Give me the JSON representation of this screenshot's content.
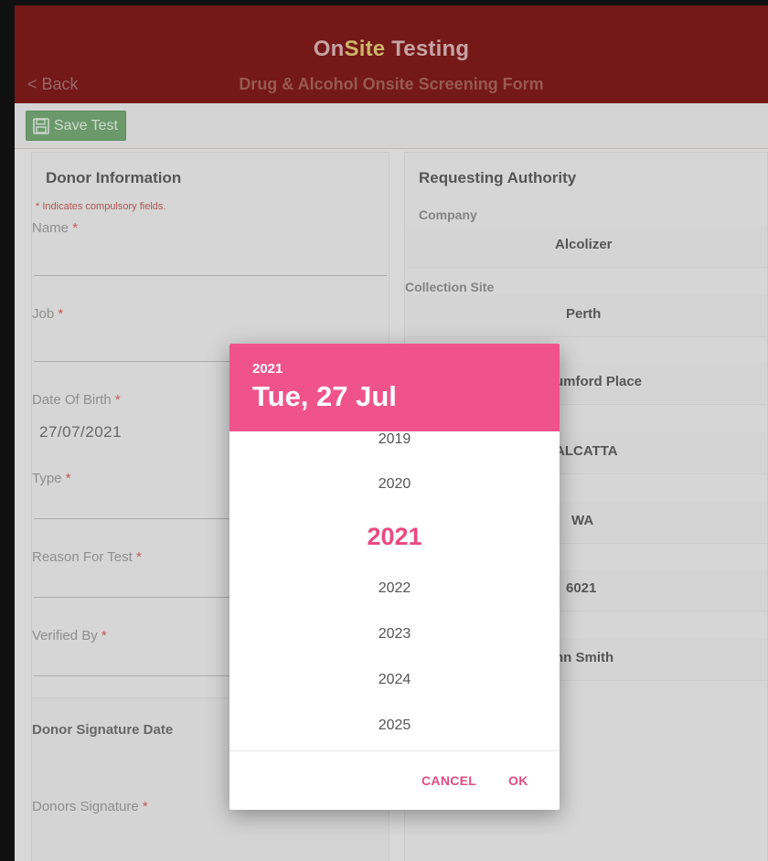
{
  "header": {
    "logo_part1": "On",
    "logo_part2": "Site",
    "logo_part3": " Testing",
    "back_label": "< Back",
    "title": "Drug & Alcohol Onsite Screening Form"
  },
  "toolbar": {
    "save_label": "Save Test"
  },
  "donor": {
    "title": "Donor Information",
    "required_note": "* Indicates compulsory fields.",
    "fields": {
      "name": "Name",
      "job": "Job",
      "dob": "Date Of Birth",
      "dob_value": "27/07/2021",
      "type": "Type",
      "reason": "Reason For Test",
      "verified": "Verified By"
    },
    "star": "*",
    "signature_date": "Donor Signature Date",
    "signature": "Donors Signature"
  },
  "authority": {
    "title": "Requesting Authority",
    "company_label": "Company",
    "company_value": "Alcolizer",
    "site_label": "Collection Site",
    "site_value": "Perth",
    "address_value": "umford Place",
    "suburb_value": "ALCATTA",
    "state_value": "WA",
    "postcode_value": "6021",
    "contact_value": "hn Smith"
  },
  "date_picker": {
    "header_year": "2021",
    "header_date": "Tue, 27 Jul",
    "years": [
      "2019",
      "2020",
      "2021",
      "2022",
      "2023",
      "2024",
      "2025"
    ],
    "selected_year": "2021",
    "cancel_label": "CANCEL",
    "ok_label": "OK",
    "accent_color": "#f0538a"
  }
}
